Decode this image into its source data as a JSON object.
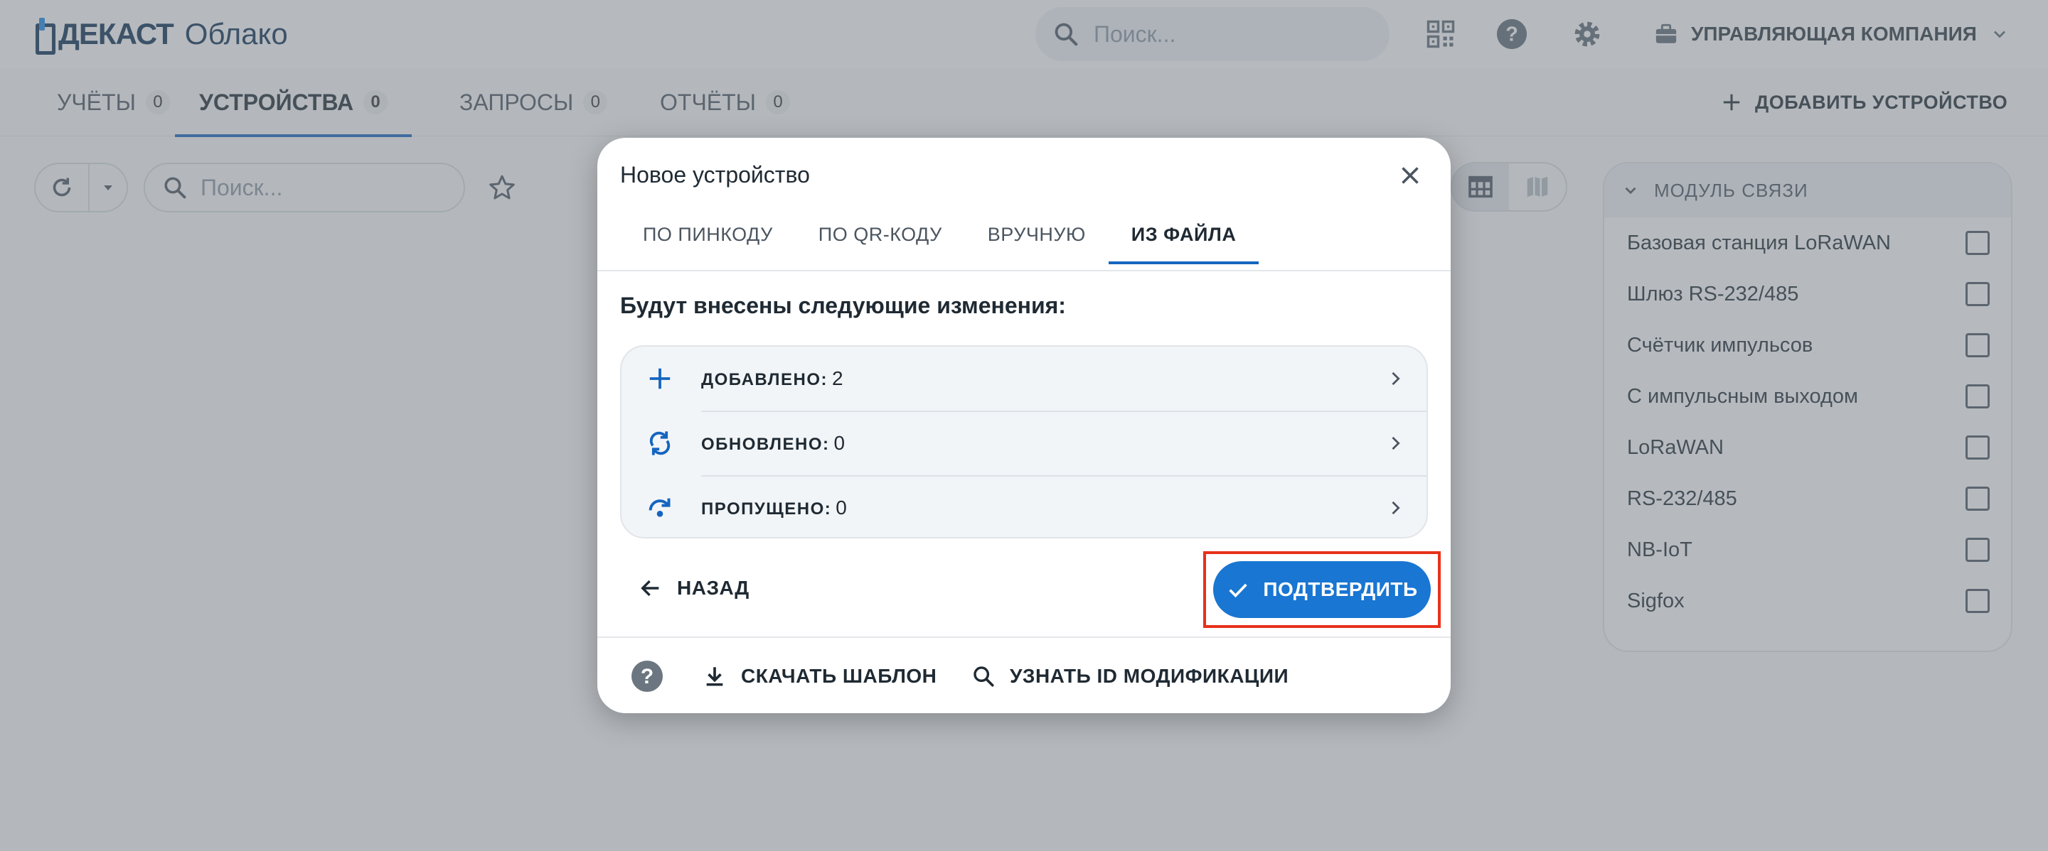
{
  "app": {
    "brand": "ДЕКАСТ",
    "product": "Облако",
    "search_placeholder": "Поиск...",
    "company": "УПРАВЛЯЮЩАЯ КОМПАНИЯ"
  },
  "main_tabs": [
    {
      "label": "УЧЁТЫ",
      "count": "0"
    },
    {
      "label": "УСТРОЙСТВА",
      "count": "0"
    },
    {
      "label": "ЗАПРОСЫ",
      "count": "0"
    },
    {
      "label": "ОТЧЁТЫ",
      "count": "0"
    }
  ],
  "add_device_label": "ДОБАВИТЬ УСТРОЙСТВО",
  "list_search_placeholder": "Поиск...",
  "filter": {
    "title": "МОДУЛЬ СВЯЗИ",
    "items": [
      "Базовая станция LoRaWAN",
      "Шлюз RS-232/485",
      "Счётчик импульсов",
      "С импульсным выходом",
      "LoRaWAN",
      "RS-232/485",
      "NB-IoT",
      "Sigfox"
    ]
  },
  "modal": {
    "title": "Новое устройство",
    "tabs": [
      "ПО ПИНКОДУ",
      "ПО QR-КОДУ",
      "ВРУЧНУЮ",
      "ИЗ ФАЙЛА"
    ],
    "changes_title": "Будут внесены следующие изменения:",
    "changes": [
      {
        "label": "ДОБАВЛЕНО:",
        "value": "2",
        "icon": "plus-icon"
      },
      {
        "label": "ОБНОВЛЕНО:",
        "value": "0",
        "icon": "sync-icon"
      },
      {
        "label": "ПРОПУЩЕНО:",
        "value": "0",
        "icon": "skip-icon"
      }
    ],
    "back_label": "НАЗАД",
    "confirm_label": "ПОДТВЕРДИТЬ",
    "download_template_label": "СКАЧАТЬ ШАБЛОН",
    "find_id_label": "УЗНАТЬ ID МОДИФИКАЦИИ"
  },
  "colors": {
    "accent": "#1976d2",
    "highlight": "#e8311a",
    "icon_blue": "#1565c0"
  }
}
